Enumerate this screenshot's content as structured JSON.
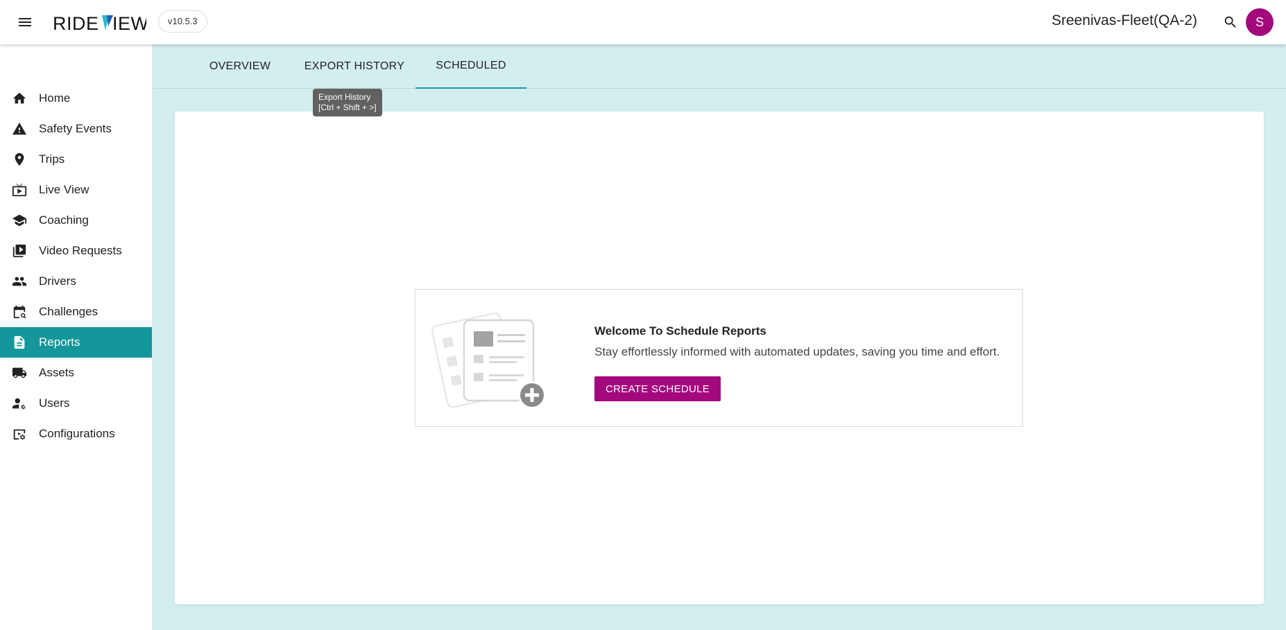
{
  "header": {
    "brand": "RIDEVIEW",
    "version": "v10.5.3",
    "fleet_name": "Sreenivas-Fleet(QA-2)",
    "avatar_initial": "S"
  },
  "sidebar": {
    "items": [
      {
        "label": "Home",
        "icon": "home-icon"
      },
      {
        "label": "Safety Events",
        "icon": "warning-icon"
      },
      {
        "label": "Trips",
        "icon": "location-pin-icon"
      },
      {
        "label": "Live View",
        "icon": "live-tv-icon"
      },
      {
        "label": "Coaching",
        "icon": "school-icon"
      },
      {
        "label": "Video Requests",
        "icon": "video-library-icon"
      },
      {
        "label": "Drivers",
        "icon": "people-icon"
      },
      {
        "label": "Challenges",
        "icon": "challenge-icon"
      },
      {
        "label": "Reports",
        "icon": "report-icon",
        "active": true
      },
      {
        "label": "Assets",
        "icon": "truck-icon"
      },
      {
        "label": "Users",
        "icon": "user-settings-icon"
      },
      {
        "label": "Configurations",
        "icon": "config-icon"
      }
    ]
  },
  "tabs": [
    {
      "label": "OVERVIEW"
    },
    {
      "label": "EXPORT HISTORY"
    },
    {
      "label": "SCHEDULED",
      "active": true
    }
  ],
  "tooltip": {
    "line1": "Export History",
    "line2": "[Ctrl + Shift + >]"
  },
  "empty_state": {
    "title": "Welcome To Schedule Reports",
    "subtitle": "Stay effortlessly informed with automated updates, saving you time and effort.",
    "button_label": "CREATE SCHEDULE"
  },
  "colors": {
    "accent": "#15969a",
    "brand": "#a3087c",
    "background": "#d3eeee"
  }
}
